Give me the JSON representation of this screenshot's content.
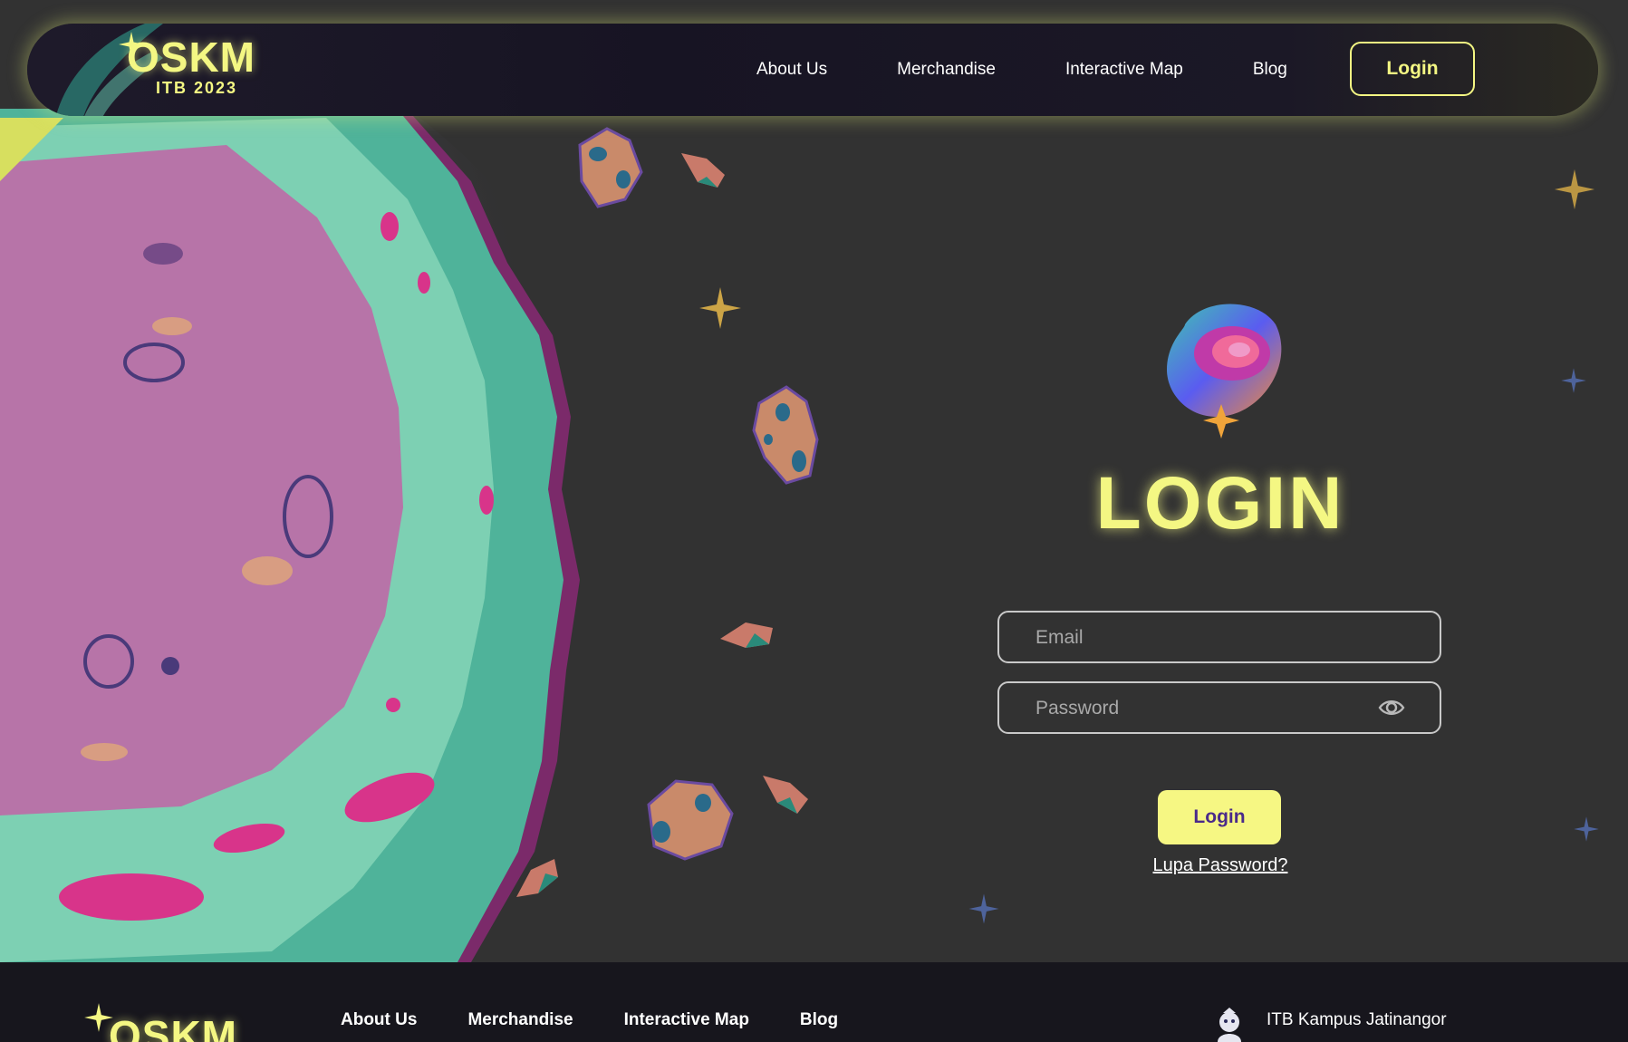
{
  "nav": {
    "brand": "OSKM",
    "brand_sub": "ITB 2023",
    "links": [
      "About Us",
      "Merchandise",
      "Interactive Map",
      "Blog"
    ],
    "login_label": "Login"
  },
  "login": {
    "title": "LOGIN",
    "email_placeholder": "Email",
    "password_placeholder": "Password",
    "submit_label": "Login",
    "forgot_label": "Lupa Password?"
  },
  "footer": {
    "brand": "OSKM",
    "links": [
      "About Us",
      "Merchandise",
      "Interactive Map",
      "Blog"
    ],
    "campus": "ITB Kampus Jatinangor"
  },
  "colors": {
    "accent": "#f4f783",
    "background": "#323232",
    "footer_bg": "#17161d",
    "button_text": "#4a2a8a"
  },
  "icons": [
    "sparkle-icon",
    "eye-icon",
    "ganesha-icon",
    "galaxy-logo-icon"
  ]
}
